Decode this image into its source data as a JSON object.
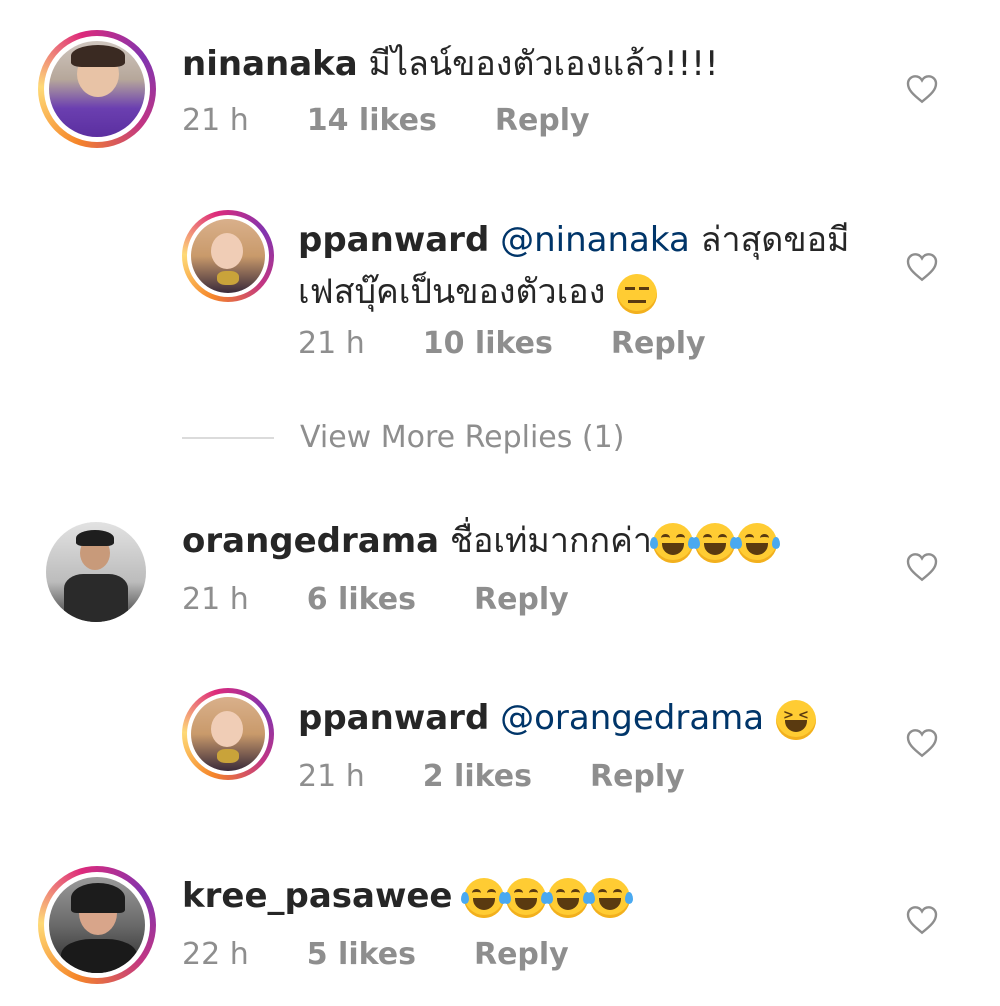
{
  "comments": [
    {
      "username": "ninanaka",
      "text": "มีไลน์ของตัวเองแล้ว!!!!",
      "time": "21 h",
      "likes": "14 likes",
      "reply": "Reply",
      "avatar": "person-purple-shirt"
    },
    {
      "username": "ppanward",
      "mention": "@ninanaka",
      "text_line1": "ล่าสุดขอมี",
      "text_line2": "เฟสบุ๊คเป็นของตัวเอง",
      "emoji": "expressionless-face",
      "time": "21 h",
      "likes": "10 likes",
      "reply": "Reply",
      "avatar": "person-blonde"
    },
    {
      "username": "orangedrama",
      "text": "ชื่อเท่มากกค่า",
      "emoji": [
        "joy-face",
        "joy-face",
        "joy-face"
      ],
      "time": "21 h",
      "likes": "6 likes",
      "reply": "Reply",
      "avatar": "person-dark-jacket"
    },
    {
      "username": "ppanward",
      "mention": "@orangedrama",
      "emoji": "laughing-face",
      "time": "21 h",
      "likes": "2 likes",
      "reply": "Reply",
      "avatar": "person-blonde"
    },
    {
      "username": "kree_pasawee",
      "emoji": [
        "joy-face",
        "joy-face",
        "joy-face",
        "joy-face"
      ],
      "time": "22 h",
      "likes": "5 likes",
      "reply": "Reply",
      "avatar": "person-dark-hair"
    }
  ],
  "view_more_replies": "View More Replies (1)",
  "icons": {
    "like": "heart-outline-icon"
  },
  "colors": {
    "text": "#262626",
    "secondary": "#8e8e8e",
    "mention": "#003569",
    "divider": "#dbdbdb"
  }
}
